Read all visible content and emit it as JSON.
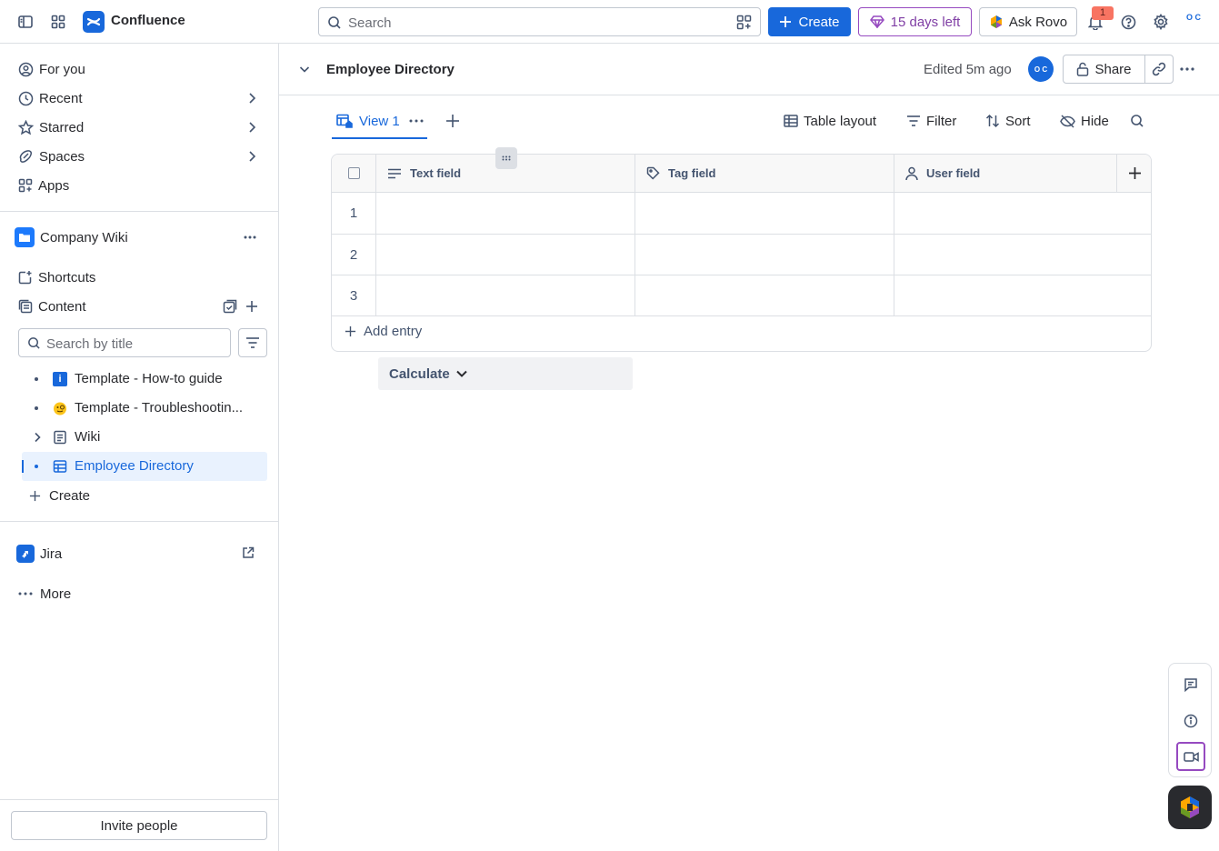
{
  "topnav": {
    "app_name": "Confluence",
    "search_placeholder": "Search",
    "create_label": "Create",
    "trial_label": "15 days left",
    "rovo_label": "Ask Rovo",
    "notification_count": "1",
    "avatar_initials": "O C"
  },
  "sidebar": {
    "nav": [
      {
        "label": "For you"
      },
      {
        "label": "Recent"
      },
      {
        "label": "Starred"
      },
      {
        "label": "Spaces"
      },
      {
        "label": "Apps"
      }
    ],
    "space_name": "Company Wiki",
    "shortcuts_label": "Shortcuts",
    "content_label": "Content",
    "search_placeholder": "Search by title",
    "tree": [
      {
        "label": "Template - How-to guide"
      },
      {
        "label": "Template - Troubleshootin..."
      },
      {
        "label": "Wiki"
      },
      {
        "label": "Employee Directory"
      }
    ],
    "create_label": "Create",
    "jira_label": "Jira",
    "more_label": "More",
    "invite_label": "Invite people"
  },
  "page": {
    "title": "Employee Directory",
    "edited": "Edited 5m ago",
    "avatar_initials": "O C",
    "share_label": "Share"
  },
  "database": {
    "view_label": "View 1",
    "toolbar": {
      "layout": "Table layout",
      "filter": "Filter",
      "sort": "Sort",
      "hide": "Hide"
    },
    "columns": [
      {
        "label": "Text field"
      },
      {
        "label": "Tag field"
      },
      {
        "label": "User field"
      }
    ],
    "rows": [
      "1",
      "2",
      "3"
    ],
    "add_entry_label": "Add entry",
    "calculate_label": "Calculate"
  },
  "colors": {
    "brand": "#1868db",
    "trial": "#803fa5",
    "active_bg": "#e9f2fe"
  }
}
